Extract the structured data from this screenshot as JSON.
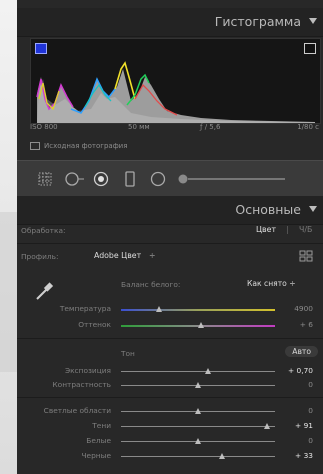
{
  "histogram": {
    "title": "Гистограмма",
    "exif": {
      "iso": "ISO 800",
      "focal": "50 мм",
      "aperture": "ƒ / 5,6",
      "shutter": "1/80 с"
    },
    "original_photo_label": "Исходная фотография"
  },
  "tools": [
    "crop-tool-icon",
    "spot-removal-icon",
    "red-eye-icon",
    "graduated-filter-icon",
    "radial-filter-icon",
    "adjustment-brush-icon"
  ],
  "basic": {
    "title": "Основные",
    "treatment_label": "Обработка:",
    "treatment_color": "Цвет",
    "treatment_bw": "Ч/Б",
    "profile_label": "Профиль:",
    "profile_value": "Adobe Цвет",
    "profile_arrows": "÷",
    "wb_label": "Баланс белого:",
    "wb_value": "Как снято ÷",
    "temperature": {
      "label": "Температура",
      "value": "4900",
      "level": 0.25
    },
    "tint": {
      "label": "Оттенок",
      "value": "+ 6",
      "level": 0.52
    },
    "tone_label": "Тон",
    "auto_label": "Авто",
    "exposure": {
      "label": "Экспозиция",
      "value": "+ 0,70",
      "level": 0.57
    },
    "contrast": {
      "label": "Контрастность",
      "value": "0",
      "level": 0.5
    },
    "highlights": {
      "label": "Светлые области",
      "value": "0",
      "level": 0.5
    },
    "shadows": {
      "label": "Тени",
      "value": "+ 91",
      "level": 0.95
    },
    "whites": {
      "label": "Белые",
      "value": "0",
      "level": 0.5
    },
    "blacks": {
      "label": "Черные",
      "value": "+ 33",
      "level": 0.66
    }
  }
}
